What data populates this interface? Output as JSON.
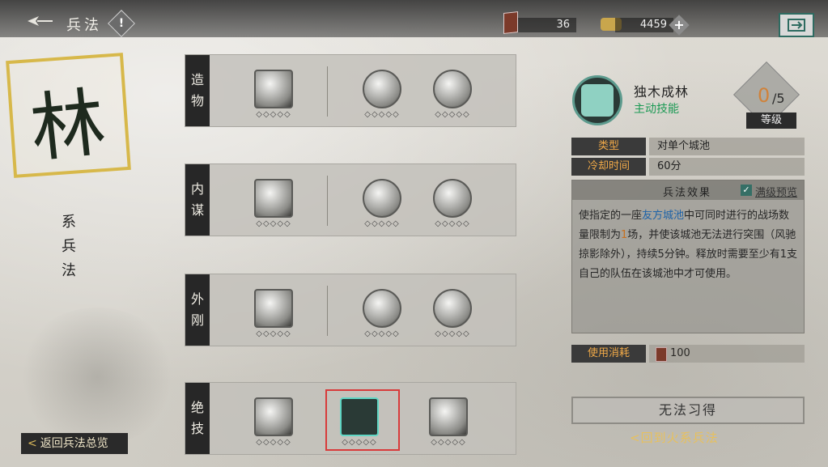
{
  "header": {
    "title": "兵法",
    "info_icon": "!",
    "resources": [
      {
        "icon": "token-icon",
        "value": "36"
      },
      {
        "icon": "gold-ingot-icon",
        "value": "4459"
      }
    ],
    "plus_symbol": "+"
  },
  "school": {
    "character": "林",
    "name": "系兵法",
    "overview_button": "返回兵法总览",
    "back_chevron": "<"
  },
  "rows": [
    {
      "label": "造物",
      "skills": [
        {
          "pips": "◇◇◇◇◇"
        },
        {
          "pips": "◇◇◇◇◇"
        },
        {
          "pips": "◇◇◇◇◇"
        }
      ]
    },
    {
      "label": "内谋",
      "skills": [
        {
          "pips": "◇◇◇◇◇"
        },
        {
          "pips": "◇◇◇◇◇"
        },
        {
          "pips": "◇◇◇◇◇"
        }
      ]
    },
    {
      "label": "外刚",
      "skills": [
        {
          "pips": "◇◇◇◇◇"
        },
        {
          "pips": "◇◇◇◇◇"
        },
        {
          "pips": "◇◇◇◇◇"
        }
      ]
    },
    {
      "label": "绝技",
      "skills": [
        {
          "pips": "◇◇◇◇◇"
        },
        {
          "pips": "◇◇◇◇◇",
          "selected": true
        },
        {
          "pips": "◇◇◇◇◇"
        }
      ]
    }
  ],
  "detail": {
    "name": "独木成林",
    "type_tag": "主动技能",
    "level_value": "0",
    "level_max": "/5",
    "level_label": "等级",
    "type_key": "类型",
    "type_value": "对单个城池",
    "cooldown_key": "冷却时间",
    "cooldown_value": "60分",
    "effect_title": "兵法效果",
    "preview_check": "✓",
    "preview_label": "满级预览",
    "effect_parts": {
      "a": "使指定的一座",
      "b": "友方城池",
      "c": "中可同时进行的战场数量限制为",
      "d": "1",
      "e": "场，并使该城池无法进行突围（风驰掠影除外），持续5分钟。释放时需要至少有1支自己的队伍在该城池中才可使用。"
    },
    "cost_key": "使用消耗",
    "cost_value": "100",
    "learn_button": "无法习得",
    "return_link": "<回到火系兵法"
  },
  "colors": {
    "accent_gold": "#d7b84a",
    "accent_green": "#1d9a55",
    "label_orange": "#f0a948",
    "highlight_blue": "#1e63a8",
    "selection_red": "#d83b3b"
  }
}
